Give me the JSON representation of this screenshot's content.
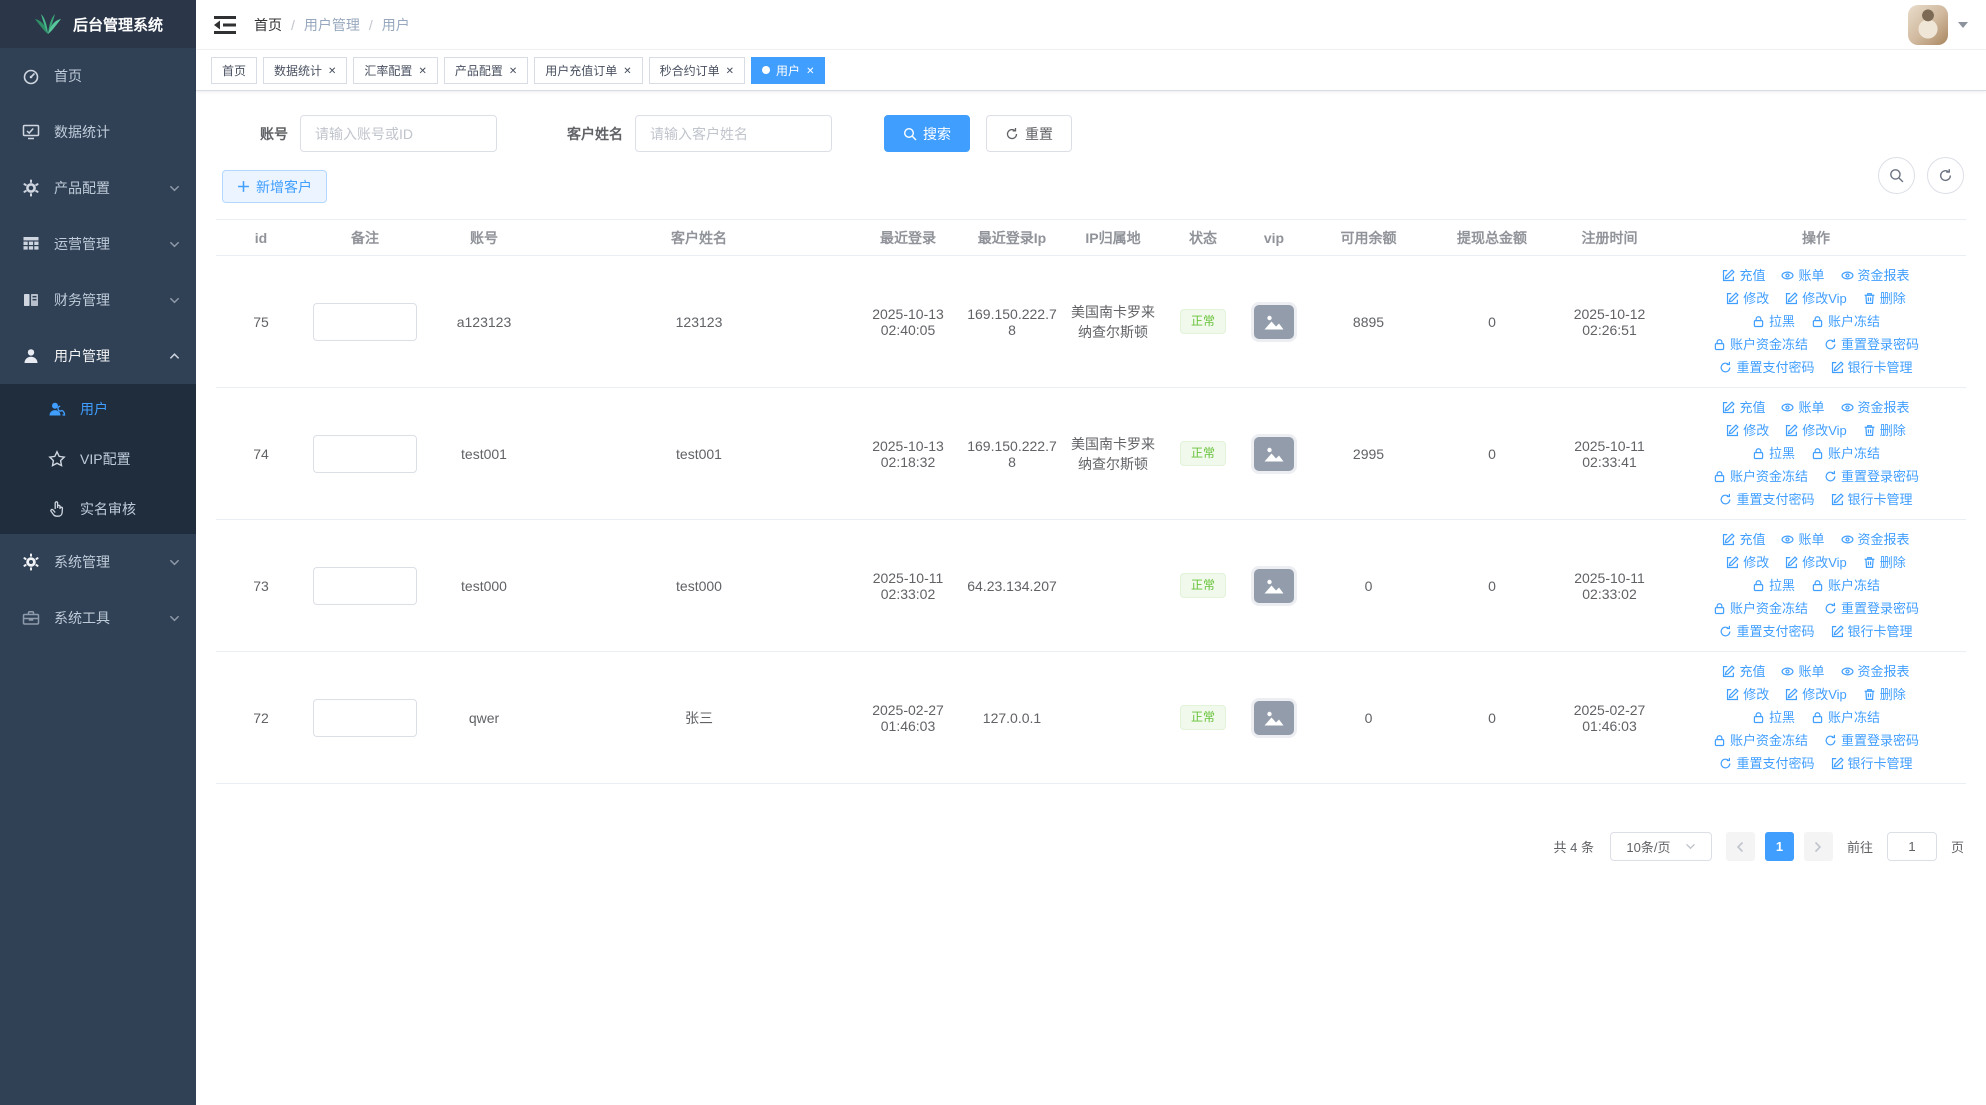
{
  "app": {
    "title": "后台管理系统"
  },
  "sidebar": {
    "items": [
      {
        "label": "首页"
      },
      {
        "label": "数据统计"
      },
      {
        "label": "产品配置"
      },
      {
        "label": "运营管理"
      },
      {
        "label": "财务管理"
      },
      {
        "label": "用户管理"
      }
    ],
    "submenu": [
      {
        "label": "用户"
      },
      {
        "label": "VIP配置"
      },
      {
        "label": "实名审核"
      }
    ],
    "items_bottom": [
      {
        "label": "系统管理"
      },
      {
        "label": "系统工具"
      }
    ]
  },
  "breadcrumb": {
    "items": [
      "首页",
      "用户管理",
      "用户"
    ],
    "separator": "/"
  },
  "tabs": [
    {
      "label": "首页"
    },
    {
      "label": "数据统计"
    },
    {
      "label": "汇率配置"
    },
    {
      "label": "产品配置"
    },
    {
      "label": "用户充值订单"
    },
    {
      "label": "秒合约订单"
    },
    {
      "label": "用户"
    }
  ],
  "filters": {
    "account_label": "账号",
    "account_placeholder": "请输入账号或ID",
    "name_label": "客户姓名",
    "name_placeholder": "请输入客户姓名",
    "search_label": "搜索",
    "reset_label": "重置",
    "add_customer_label": "新增客户"
  },
  "table": {
    "columns": [
      "id",
      "备注",
      "账号",
      "客户姓名",
      "最近登录",
      "最近登录Ip",
      "IP归属地",
      "状态",
      "vip",
      "可用余额",
      "提现总金额",
      "注册时间",
      "操作"
    ],
    "ops": [
      {
        "name": "recharge",
        "label": "充值",
        "icon": "edit-icon"
      },
      {
        "name": "bills",
        "label": "账单",
        "icon": "view-icon"
      },
      {
        "name": "funds-report",
        "label": "资金报表",
        "icon": "view-icon"
      },
      {
        "name": "edit",
        "label": "修改",
        "icon": "edit-icon"
      },
      {
        "name": "edit-vip",
        "label": "修改Vip",
        "icon": "edit-icon"
      },
      {
        "name": "delete",
        "label": "删除",
        "icon": "delete-icon"
      },
      {
        "name": "blacklist",
        "label": "拉黑",
        "icon": "lock-icon"
      },
      {
        "name": "freeze-account",
        "label": "账户冻结",
        "icon": "lock-icon"
      },
      {
        "name": "freeze-funds",
        "label": "账户资金冻结",
        "icon": "lock-icon"
      },
      {
        "name": "reset-login-password",
        "label": "重置登录密码",
        "icon": "refresh-icon"
      },
      {
        "name": "reset-pay-password",
        "label": "重置支付密码",
        "icon": "refresh-icon"
      },
      {
        "name": "bank-card-management",
        "label": "银行卡管理",
        "icon": "edit-icon"
      }
    ],
    "rows": [
      {
        "id": "75",
        "remark": "",
        "account": "a123123",
        "name": "123123",
        "last_login": "2025-10-13 02:40:05",
        "last_ip": "169.150.222.78",
        "ip_location": "美国南卡罗来纳查尔斯顿",
        "status": "正常",
        "balance": "8895",
        "withdraw_total": "0",
        "register_time": "2025-10-12 02:26:51"
      },
      {
        "id": "74",
        "remark": "",
        "account": "test001",
        "name": "test001",
        "last_login": "2025-10-13 02:18:32",
        "last_ip": "169.150.222.78",
        "ip_location": "美国南卡罗来纳查尔斯顿",
        "status": "正常",
        "balance": "2995",
        "withdraw_total": "0",
        "register_time": "2025-10-11 02:33:41"
      },
      {
        "id": "73",
        "remark": "",
        "account": "test000",
        "name": "test000",
        "last_login": "2025-10-11 02:33:02",
        "last_ip": "64.23.134.207",
        "ip_location": "",
        "status": "正常",
        "balance": "0",
        "withdraw_total": "0",
        "register_time": "2025-10-11 02:33:02"
      },
      {
        "id": "72",
        "remark": "",
        "account": "qwer",
        "name": "张三",
        "last_login": "2025-02-27 01:46:03",
        "last_ip": "127.0.0.1",
        "ip_location": "",
        "status": "正常",
        "balance": "0",
        "withdraw_total": "0",
        "register_time": "2025-02-27 01:46:03"
      }
    ]
  },
  "pagination": {
    "total_label": "共 4 条",
    "page_size_label": "10条/页",
    "current_page": "1",
    "goto_label": "前往",
    "goto_value": "1",
    "page_unit": "页"
  },
  "colors": {
    "accent": "#409EFF",
    "sidebar_bg": "#304156",
    "submenu_bg": "#1f2d3d",
    "success": "#67c23a",
    "logo_green": "#3aa678"
  }
}
